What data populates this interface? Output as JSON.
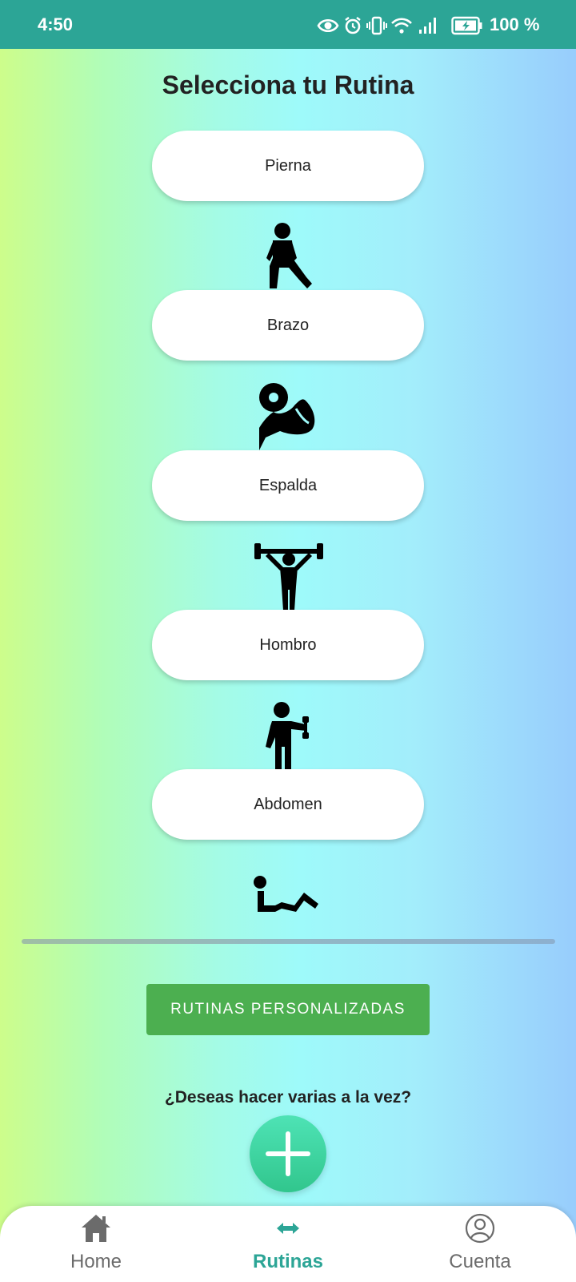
{
  "status_bar": {
    "time": "4:50",
    "battery_text": "100 %",
    "icons": [
      "eye-icon",
      "alarm-icon",
      "vibrate-icon",
      "wifi-icon",
      "signal-icon",
      "battery-charging-icon"
    ]
  },
  "page": {
    "title": "Selecciona tu Rutina"
  },
  "routines": [
    {
      "label": "Pierna",
      "icon": "leg-stretch-icon"
    },
    {
      "label": "Brazo",
      "icon": "bicep-flex-icon"
    },
    {
      "label": "Espalda",
      "icon": "weightlifter-icon"
    },
    {
      "label": "Hombro",
      "icon": "dumbbell-raise-icon"
    },
    {
      "label": "Abdomen",
      "icon": "situp-icon"
    }
  ],
  "custom_routines_button": "RUTINAS PERSONALIZADAS",
  "multi_question": "¿Deseas hacer varias a la vez?",
  "fab_icon": "plus-icon",
  "bottom_nav": {
    "items": [
      {
        "label": "Home",
        "icon": "home-icon",
        "active": false
      },
      {
        "label": "Rutinas",
        "icon": "arrows-horizontal-icon",
        "active": true
      },
      {
        "label": "Cuenta",
        "icon": "account-icon",
        "active": false
      }
    ]
  },
  "colors": {
    "status_bar": "#2ca596",
    "accent_green": "#4caf50",
    "nav_active": "#2ca596",
    "nav_inactive": "#6b6b6b"
  }
}
